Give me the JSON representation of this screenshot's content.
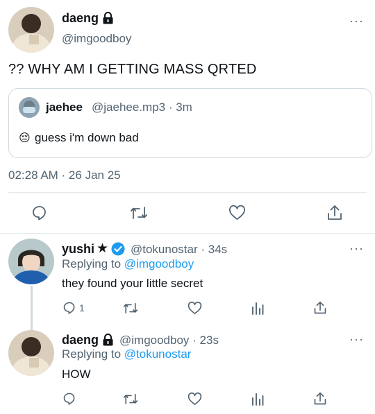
{
  "main_tweet": {
    "display_name": "daeng",
    "handle": "@imgoodboy",
    "text": "?? WHY AM I GETTING MASS QRTED",
    "timestamp": "02:28 AM · 26 Jan 25",
    "more_label": "···"
  },
  "quoted_tweet": {
    "display_name": "jaehee",
    "handle_time": "@jaehee.mp3 · 3m",
    "emoji": "😔",
    "text": "guess i'm down bad"
  },
  "replies": [
    {
      "display_name": "yushi",
      "star": "★",
      "handle_time": "@tokunostar · 34s",
      "replying_prefix": "Replying to",
      "replying_handle": "@imgoodboy",
      "text": "they found your little secret",
      "reply_count": "1"
    },
    {
      "display_name": "daeng",
      "handle_time": "@imgoodboy · 23s",
      "replying_prefix": "Replying to",
      "replying_handle": "@tokunostar",
      "text": "HOW",
      "reply_count": ""
    }
  ],
  "colors": {
    "accent": "#1d9bf0",
    "text": "#0f1419",
    "muted": "#536471",
    "divider": "#e6e9ec"
  }
}
